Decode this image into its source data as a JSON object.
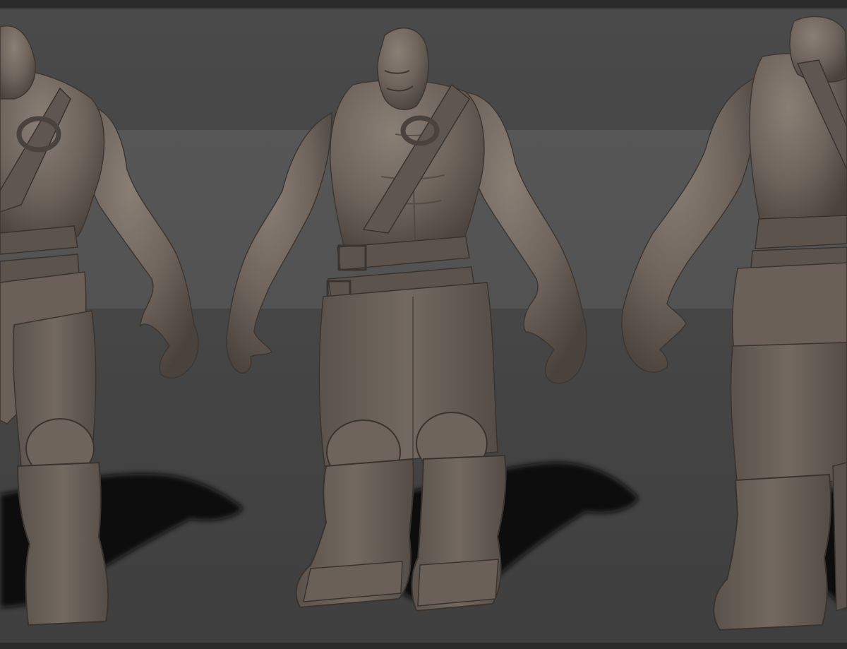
{
  "scene": {
    "description_tag": "sculpt-turnaround",
    "colors": {
      "clay": "#6e645c",
      "clay_light": "#8a7f75",
      "clay_dark": "#4a423c",
      "shadow": "#0b0b0b",
      "bg_top": "#4a4a4a",
      "bg_mid": "#575757",
      "bg_floor": "#434343",
      "frame": "#2a2a2a"
    },
    "figures": [
      {
        "view": "front-three-quarter-left"
      },
      {
        "view": "front-three-quarter"
      },
      {
        "view": "back-three-quarter"
      }
    ]
  }
}
